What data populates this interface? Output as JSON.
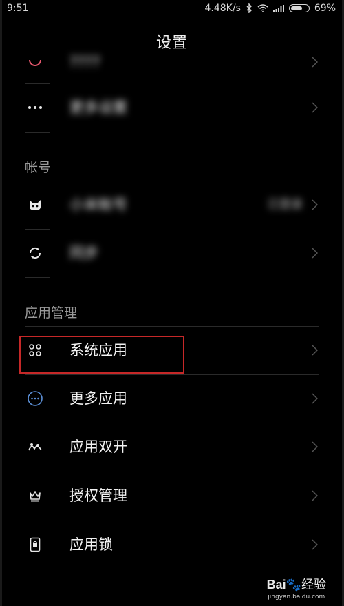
{
  "status_bar": {
    "time": "9:51",
    "network_speed": "4.48K/s",
    "battery_percent": "69%",
    "battery_level": 0.69,
    "icons": [
      "bluetooth-icon",
      "wifi-icon",
      "signal-icon",
      "battery-icon"
    ]
  },
  "header": {
    "title": "设置"
  },
  "top_rows": [
    {
      "label": "????",
      "icon": "ring-icon",
      "blurred": true
    },
    {
      "label": "更多设置",
      "icon": "more-icon",
      "blurred": true
    }
  ],
  "account_section": {
    "title": "帐号",
    "rows": [
      {
        "label": "小米帐号",
        "value": "已登录",
        "icon": "mi-account-icon",
        "blurred": true
      },
      {
        "label": "同步",
        "icon": "sync-icon",
        "blurred": true
      }
    ]
  },
  "app_section": {
    "title": "应用管理",
    "rows": [
      {
        "label": "系统应用",
        "icon": "system-apps-icon",
        "highlighted": true
      },
      {
        "label": "更多应用",
        "icon": "more-apps-icon"
      },
      {
        "label": "应用双开",
        "icon": "dual-apps-icon"
      },
      {
        "label": "授权管理",
        "icon": "permissions-icon"
      },
      {
        "label": "应用锁",
        "icon": "app-lock-icon"
      }
    ]
  },
  "watermark": {
    "logo_prefix": "Bai",
    "logo_suffix": "经验",
    "url": "jingyan.baidu.com"
  },
  "colors": {
    "background": "#000000",
    "highlight": "#c62828",
    "divider": "#2a2a2a",
    "more_apps_icon": "#5b8fd6"
  }
}
